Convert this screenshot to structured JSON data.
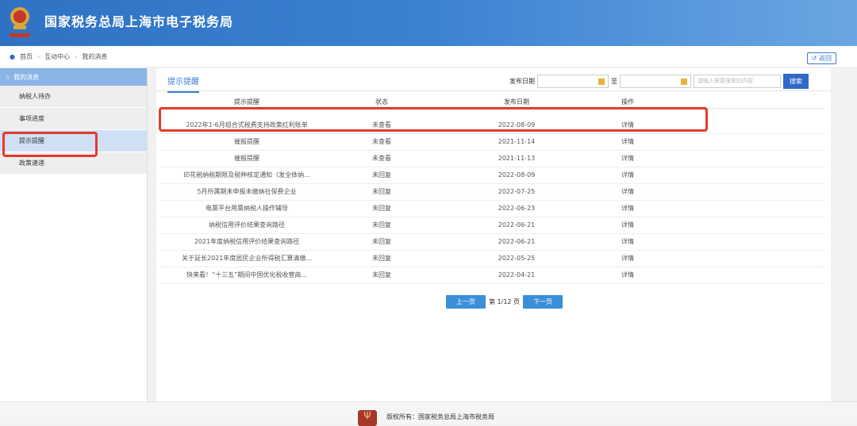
{
  "header": {
    "title": "国家税务总局上海市电子税务局"
  },
  "breadcrumb": [
    "首页",
    "互动中心",
    "我的消息"
  ],
  "back_label": "返回",
  "sidebar": {
    "heading": "我的消息",
    "items": [
      {
        "label": "纳税人待办"
      },
      {
        "label": "事项进度"
      },
      {
        "label": "提示提醒",
        "active": true
      },
      {
        "label": "政策速递"
      }
    ]
  },
  "main": {
    "tab": "提示提醒",
    "filter": {
      "date_label": "发布日期",
      "to_label": "至",
      "date_from": "",
      "date_to": "",
      "search_placeholder": "请输入需要搜索的内容",
      "search_button": "搜索"
    },
    "columns": [
      "提示提醒",
      "状态",
      "发布日期",
      "操作"
    ],
    "rows": [
      {
        "title": "2022年1-6月组合式税费支持政策红利账单",
        "status": "未查看",
        "date": "2022-08-09",
        "action": "详情"
      },
      {
        "title": "催报提醒",
        "status": "未查看",
        "date": "2021-11-14",
        "action": "详情"
      },
      {
        "title": "催报提醒",
        "status": "未查看",
        "date": "2021-11-13",
        "action": "详情"
      },
      {
        "title": "印花税纳税期限及税种核定通知（发全体纳...",
        "status": "未回复",
        "date": "2022-08-09",
        "action": "详情"
      },
      {
        "title": "5月所属期未申报未缴纳社保费企业",
        "status": "未回复",
        "date": "2022-07-25",
        "action": "详情"
      },
      {
        "title": "电票平台用票纳税人操作辅导",
        "status": "未回复",
        "date": "2022-06-23",
        "action": "详情"
      },
      {
        "title": "纳税信用评价结果查询路径",
        "status": "未回复",
        "date": "2022-06-21",
        "action": "详情"
      },
      {
        "title": "2021年度纳税信用评价结果查询路径",
        "status": "未回复",
        "date": "2022-06-21",
        "action": "详情"
      },
      {
        "title": "关于延长2021年度居民企业所得税汇算清缴...",
        "status": "未回复",
        "date": "2022-05-25",
        "action": "详情"
      },
      {
        "title": "快来看！“十三五”期间中国优化税收营商...",
        "status": "未回复",
        "date": "2022-04-21",
        "action": "详情"
      }
    ],
    "pager": {
      "prev": "上一页",
      "info": "第 1/12 页",
      "next": "下一页"
    }
  },
  "footer": {
    "copyright": "版权所有：国家税务总局上海市税务局"
  },
  "colors": {
    "header": "#3b82d2",
    "accent": "#3a7bd5",
    "highlight": "#e23b2a"
  }
}
